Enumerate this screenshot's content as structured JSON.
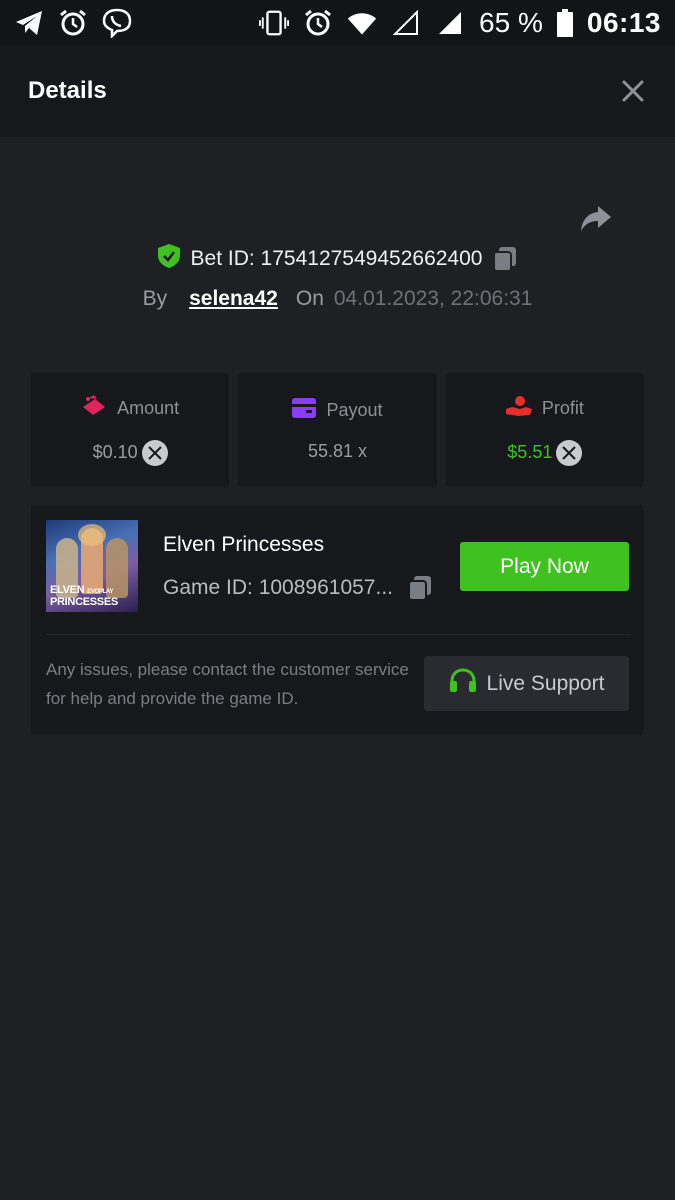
{
  "status_bar": {
    "battery": "65 %",
    "time": "06:13",
    "icons": [
      "telegram-icon",
      "alarm-icon",
      "viber-icon",
      "vibrate-icon",
      "alarm-icon",
      "wifi-icon",
      "signal-empty-icon",
      "signal-icon",
      "battery-icon"
    ]
  },
  "header": {
    "title": "Details"
  },
  "bet": {
    "id_text": "Bet ID: 1754127549452662400",
    "by_label": "By",
    "username": "selena42",
    "on_label": "On",
    "datetime": "04.01.2023, 22:06:31"
  },
  "stats": [
    {
      "label": "Amount",
      "value": "$0.10",
      "icon": "amount-icon",
      "color": "#e0245e"
    },
    {
      "label": "Payout",
      "value": "55.81 x",
      "icon": "wallet-icon",
      "color": "#8b3dff"
    },
    {
      "label": "Profit",
      "value": "$5.51",
      "icon": "profit-hand-icon",
      "color": "#e3302c"
    }
  ],
  "game": {
    "thumbnail_title_line1": "ELVEN",
    "thumbnail_title_line2": "PRINCESSES",
    "thumbnail_brand": "EVOPLAY",
    "name": "Elven Princesses",
    "game_id": "Game ID: 1008961057...",
    "play_label": "Play Now",
    "help_text": "Any issues, please contact the customer service for help and provide the game ID.",
    "support_label": "Live Support"
  },
  "colors": {
    "accent_green": "#3fc21f",
    "background": "#1f2024",
    "card": "#17181b"
  }
}
